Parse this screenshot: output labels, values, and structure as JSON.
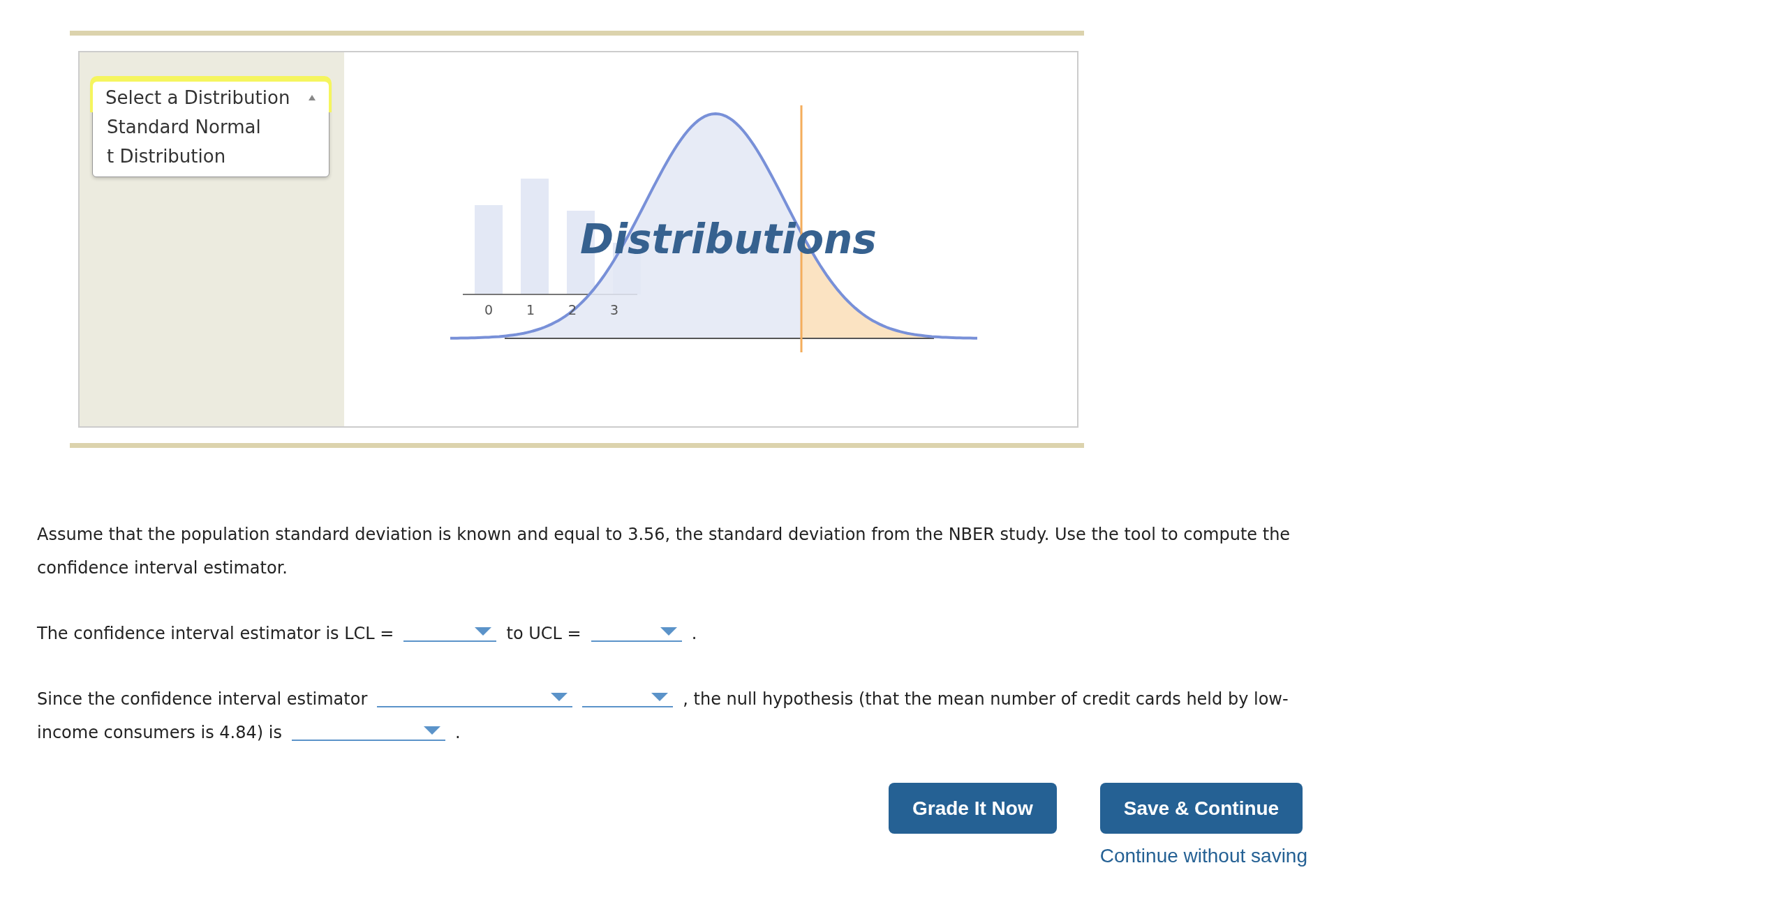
{
  "distribution_menu": {
    "placeholder": "Select a Distribution",
    "expanded": true,
    "options": [
      {
        "label": "Standard Normal",
        "selected": false
      },
      {
        "label": "t Distribution",
        "selected": false
      }
    ]
  },
  "logo": {
    "title": "Distributions",
    "tick_labels": [
      "0",
      "1",
      "2",
      "3"
    ]
  },
  "question": {
    "intro": "Assume that the population standard deviation is known and equal to 3.56, the standard deviation from the NBER study. Use the tool to compute the confidence interval estimator.",
    "sentences": [
      {
        "parts": [
          {
            "kind": "text",
            "text": "The confidence interval estimator is LCL ="
          },
          {
            "kind": "dropdown"
          },
          {
            "kind": "text",
            "text": "to UCL ="
          },
          {
            "kind": "dropdown"
          },
          {
            "kind": "text",
            "text": "."
          }
        ]
      },
      {
        "parts": [
          {
            "kind": "text",
            "text": "Since the confidence interval estimator"
          },
          {
            "kind": "dropdown"
          },
          {
            "kind": "dropdown"
          },
          {
            "kind": "text",
            "text": ", the null hypothesis (that the mean number of credit cards held by low-"
          },
          {
            "kind": "text",
            "text": "income consumers is 4.84) is"
          },
          {
            "kind": "dropdown"
          },
          {
            "kind": "text",
            "text": "."
          }
        ]
      }
    ]
  },
  "buttons": [
    {
      "label": "Grade It Now"
    },
    {
      "label": "Save & Continue"
    }
  ],
  "link": "Continue without saving"
}
